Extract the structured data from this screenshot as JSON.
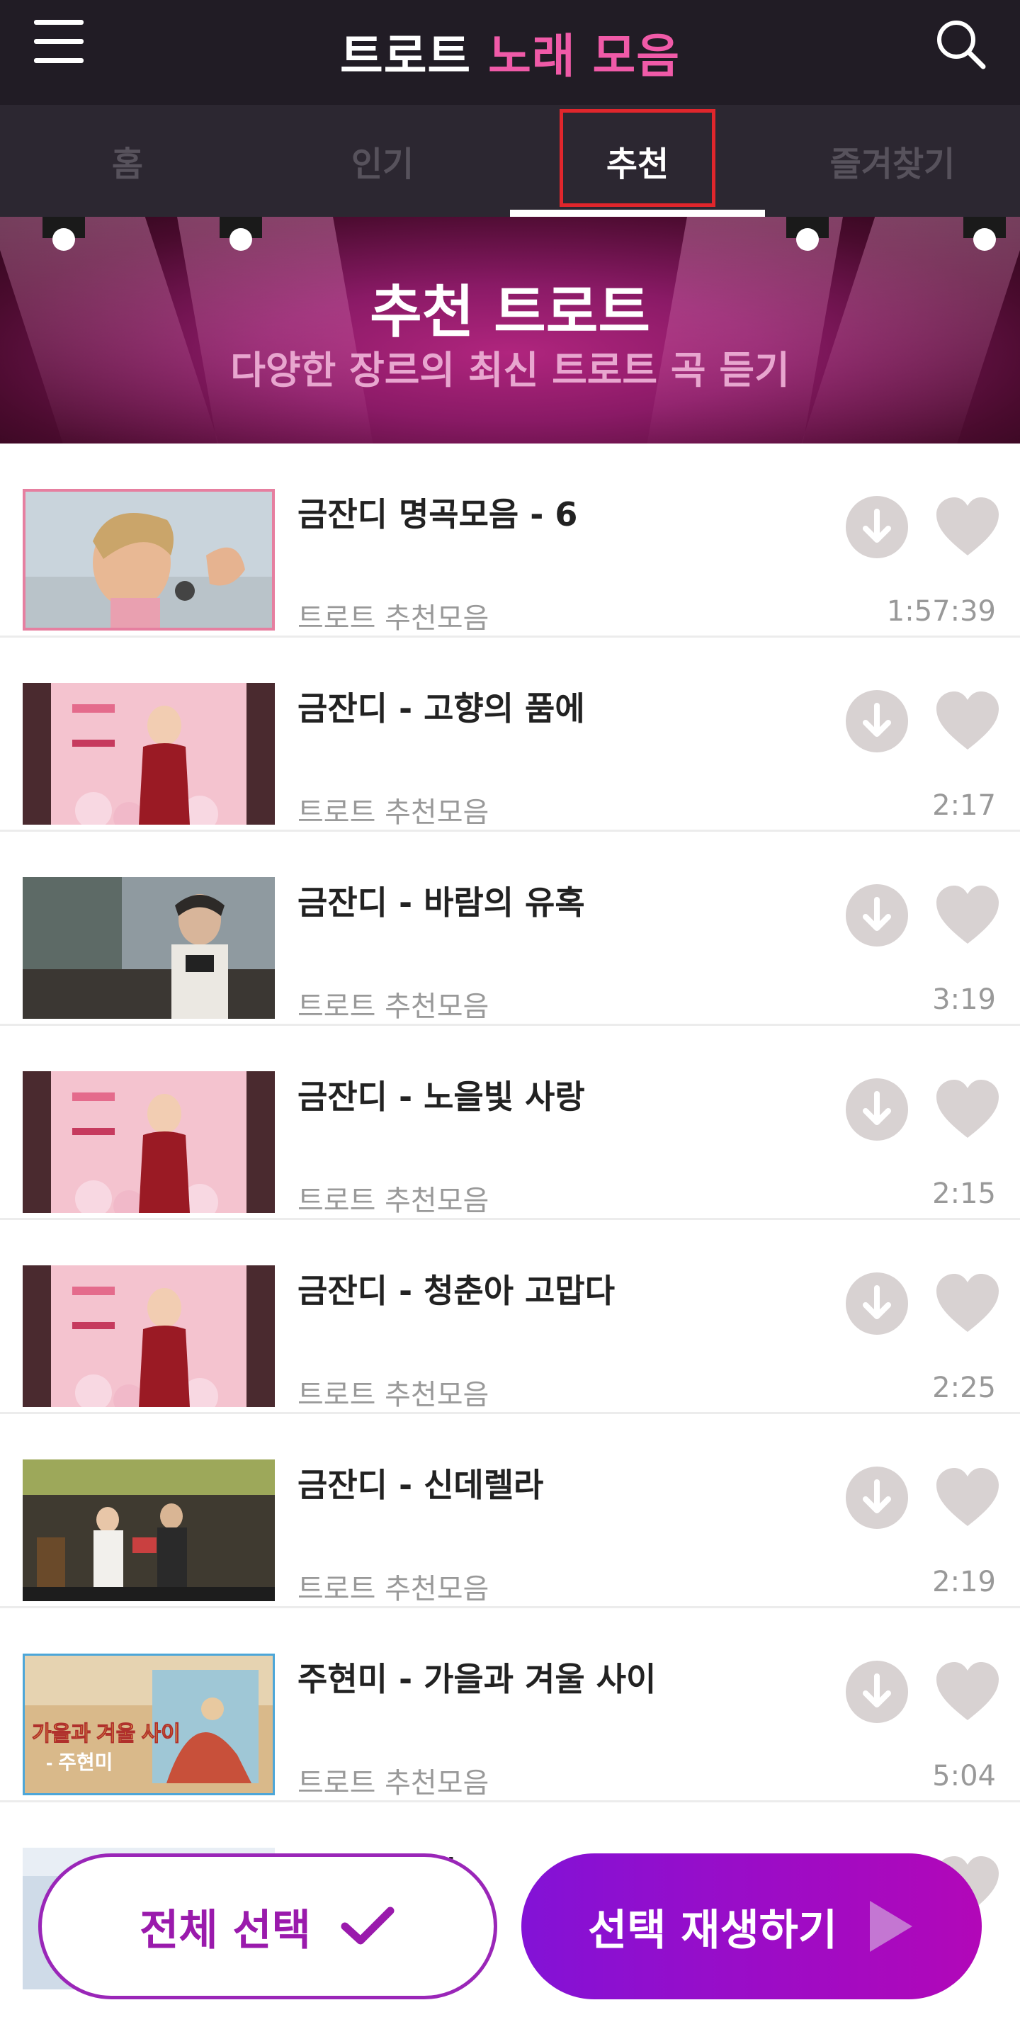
{
  "header": {
    "title_part1": "트로트",
    "title_part2": "노래 모음",
    "menu_icon": "hamburger-menu-icon",
    "search_icon": "search-icon"
  },
  "tabs": [
    {
      "label": "홈",
      "active": false
    },
    {
      "label": "인기",
      "active": false
    },
    {
      "label": "추천",
      "active": true
    },
    {
      "label": "즐겨찾기",
      "active": false
    }
  ],
  "banner": {
    "title": "추천 트로트",
    "subtitle": "다양한 장르의 최신 트로트 곡 듣기"
  },
  "songs": [
    {
      "title": "금잔디 명곡모음 - 6",
      "subtitle": "트로트 추천모음",
      "duration": "1:57:39"
    },
    {
      "title": "금잔디 - 고향의 품에",
      "subtitle": "트로트 추천모음",
      "duration": "2:17"
    },
    {
      "title": "금잔디 - 바람의 유혹",
      "subtitle": "트로트 추천모음",
      "duration": "3:19"
    },
    {
      "title": "금잔디 - 노을빛 사랑",
      "subtitle": "트로트 추천모음",
      "duration": "2:15"
    },
    {
      "title": "금잔디 - 청춘아 고맙다",
      "subtitle": "트로트 추천모음",
      "duration": "2:25"
    },
    {
      "title": "금잔디 - 신데렐라",
      "subtitle": "트로트 추천모음",
      "duration": "2:19"
    },
    {
      "title": "주현미 - 가을과 겨울 사이",
      "subtitle": "트로트 추천모음",
      "duration": "5:04"
    },
    {
      "title": "제비",
      "subtitle": "",
      "duration": ""
    }
  ],
  "thumb7_text": {
    "line1": "가을과 겨울 사이",
    "line2": "- 주현미"
  },
  "bottom": {
    "select_all_label": "전체 선택",
    "play_selected_label": "선택 재생하기"
  },
  "colors": {
    "header_bg": "#211c25",
    "tabs_bg": "#2c2731",
    "accent_pink": "#f05aa8",
    "highlight_red": "#e0262c",
    "purple": "#9a1aac"
  }
}
